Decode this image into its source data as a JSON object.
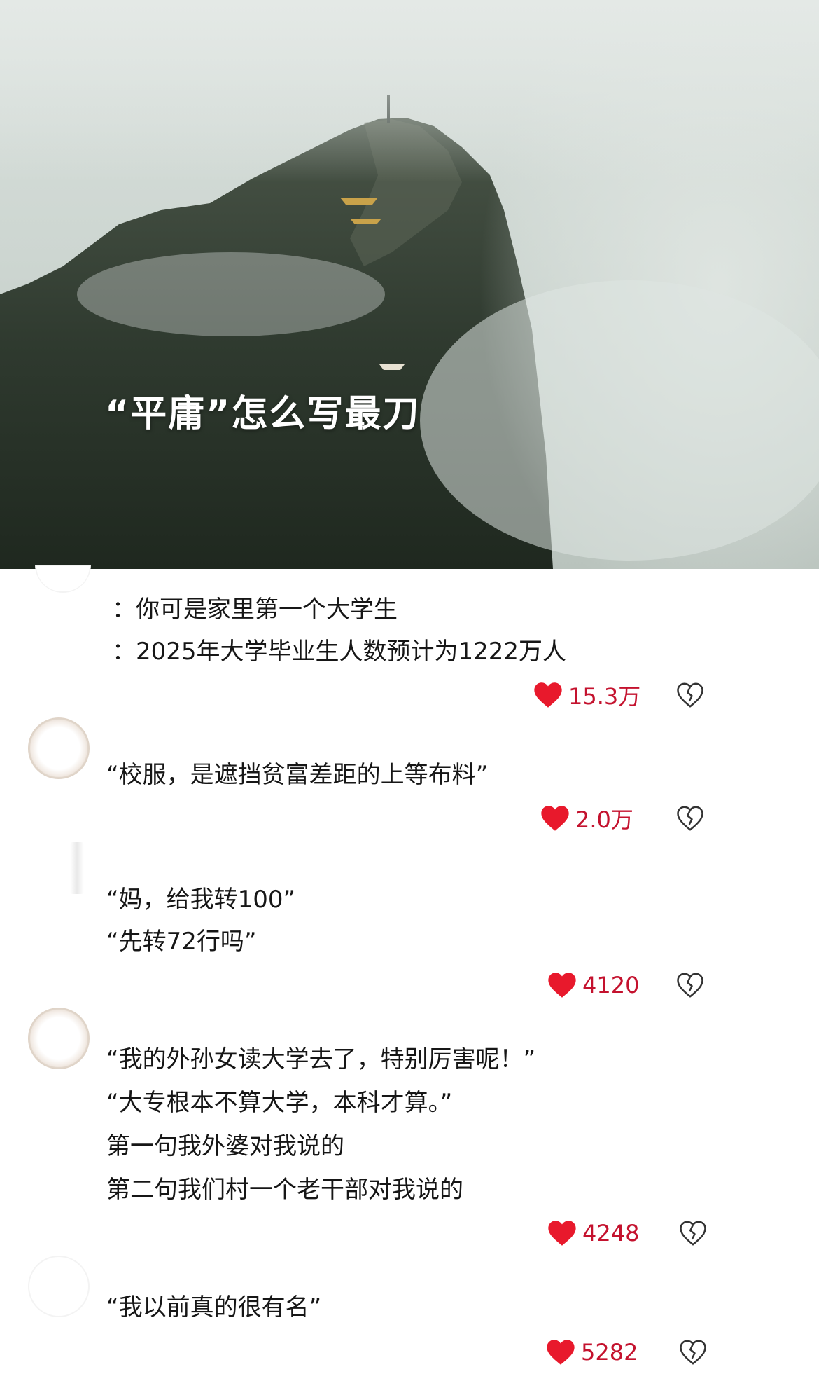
{
  "hero": {
    "title": "“平庸”怎么写最刀"
  },
  "colors": {
    "like_red": "#e8192c",
    "count_red": "#c4122e"
  },
  "comments": [
    {
      "lines": [
        "：你可是家里第一个大学生",
        "：2025年大学毕业生人数预计为1222万人"
      ],
      "likes": "15.3万"
    },
    {
      "lines": [
        "“校服，是遮挡贫富差距的上等布料”"
      ],
      "likes": "2.0万"
    },
    {
      "lines": [
        "“妈，给我转100”",
        "“先转72行吗”"
      ],
      "likes": "4120"
    },
    {
      "lines": [
        "“我的外孙女读大学去了，特别厉害呢！”",
        "“大专根本不算大学，本科才算。”",
        "第一句我外婆对我说的",
        "第二句我们村一个老干部对我说的"
      ],
      "likes": "4248"
    },
    {
      "lines": [
        "“我以前真的很有名”"
      ],
      "likes": "5282"
    }
  ],
  "icons": {
    "like": "heart-icon",
    "dislike": "broken-heart-icon"
  }
}
